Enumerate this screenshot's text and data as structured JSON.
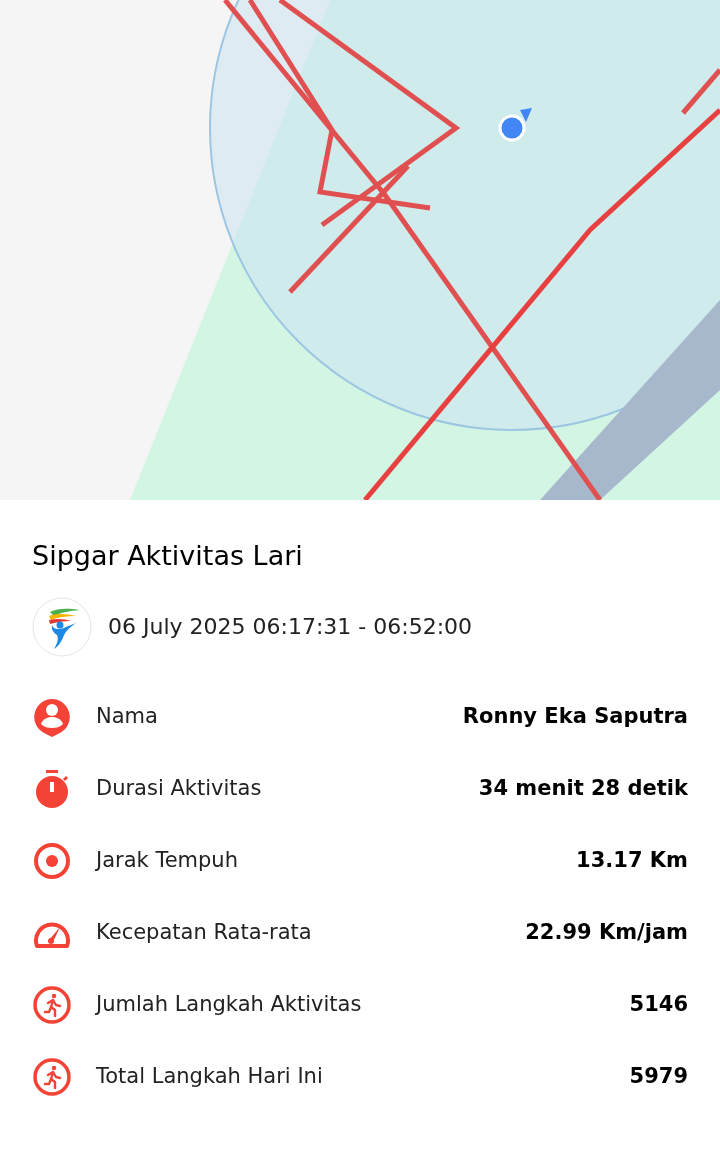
{
  "title": "Sipgar Aktivitas Lari",
  "datetime": "06 July 2025 06:17:31 - 06:52:00",
  "stats": [
    {
      "kind": "person",
      "label": "Nama",
      "value": "Ronny Eka Saputra"
    },
    {
      "kind": "stopwatch",
      "label": "Durasi Aktivitas",
      "value": "34 menit 28 detik"
    },
    {
      "kind": "target",
      "label": "Jarak Tempuh",
      "value": "13.17 Km"
    },
    {
      "kind": "speed",
      "label": "Kecepatan Rata-rata",
      "value": "22.99 Km/jam"
    },
    {
      "kind": "runner",
      "label": "Jumlah Langkah Aktivitas",
      "value": "5146"
    },
    {
      "kind": "runner",
      "label": "Total Langkah Hari Ini",
      "value": "5979"
    }
  ]
}
